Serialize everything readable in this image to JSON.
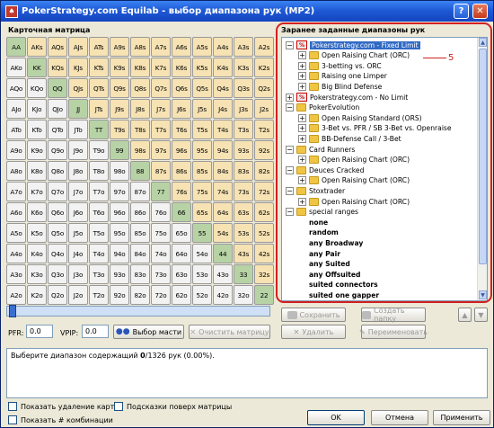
{
  "window": {
    "title": "PokerStrategy.com Equilab - выбор диапазона рук (MP2)",
    "help": "?",
    "close": "✕"
  },
  "matrix": {
    "label": "Карточная матрица",
    "rows": [
      [
        "AA",
        "AKs",
        "AQs",
        "AJs",
        "ATs",
        "A9s",
        "A8s",
        "A7s",
        "A6s",
        "A5s",
        "A4s",
        "A3s",
        "A2s"
      ],
      [
        "AKo",
        "KK",
        "KQs",
        "KJs",
        "KTs",
        "K9s",
        "K8s",
        "K7s",
        "K6s",
        "K5s",
        "K4s",
        "K3s",
        "K2s"
      ],
      [
        "AQo",
        "KQo",
        "QQ",
        "QJs",
        "QTs",
        "Q9s",
        "Q8s",
        "Q7s",
        "Q6s",
        "Q5s",
        "Q4s",
        "Q3s",
        "Q2s"
      ],
      [
        "AJo",
        "KJo",
        "QJo",
        "JJ",
        "JTs",
        "J9s",
        "J8s",
        "J7s",
        "J6s",
        "J5s",
        "J4s",
        "J3s",
        "J2s"
      ],
      [
        "ATo",
        "KTo",
        "QTo",
        "JTo",
        "TT",
        "T9s",
        "T8s",
        "T7s",
        "T6s",
        "T5s",
        "T4s",
        "T3s",
        "T2s"
      ],
      [
        "A9o",
        "K9o",
        "Q9o",
        "J9o",
        "T9o",
        "99",
        "98s",
        "97s",
        "96s",
        "95s",
        "94s",
        "93s",
        "92s"
      ],
      [
        "A8o",
        "K8o",
        "Q8o",
        "J8o",
        "T8o",
        "98o",
        "88",
        "87s",
        "86s",
        "85s",
        "84s",
        "83s",
        "82s"
      ],
      [
        "A7o",
        "K7o",
        "Q7o",
        "J7o",
        "T7o",
        "97o",
        "87o",
        "77",
        "76s",
        "75s",
        "74s",
        "73s",
        "72s"
      ],
      [
        "A6o",
        "K6o",
        "Q6o",
        "J6o",
        "T6o",
        "96o",
        "86o",
        "76o",
        "66",
        "65s",
        "64s",
        "63s",
        "62s"
      ],
      [
        "A5o",
        "K5o",
        "Q5o",
        "J5o",
        "T5o",
        "95o",
        "85o",
        "75o",
        "65o",
        "55",
        "54s",
        "53s",
        "52s"
      ],
      [
        "A4o",
        "K4o",
        "Q4o",
        "J4o",
        "T4o",
        "94o",
        "84o",
        "74o",
        "64o",
        "54o",
        "44",
        "43s",
        "42s"
      ],
      [
        "A3o",
        "K3o",
        "Q3o",
        "J3o",
        "T3o",
        "93o",
        "83o",
        "73o",
        "63o",
        "53o",
        "43o",
        "33",
        "32s"
      ],
      [
        "A2o",
        "K2o",
        "Q2o",
        "J2o",
        "T2o",
        "92o",
        "82o",
        "72o",
        "62o",
        "52o",
        "42o",
        "32o",
        "22"
      ]
    ]
  },
  "controls": {
    "pfr_label": "PFR:",
    "pfr_value": "0.0",
    "vpip_label": "VPIP:",
    "vpip_value": "0.0",
    "suit_button": "Выбор масти",
    "clear_button": "Очистить матрицу"
  },
  "presets": {
    "label": "Заранее заданные диапазоны рук",
    "annotation": "5",
    "save": "Сохранить",
    "delete": "Удалить",
    "new_folder": "Создать папку",
    "rename": "Переименовать",
    "tree": [
      {
        "d": 0,
        "t": "minus",
        "i": "ps",
        "text": "Pokerstrategy.com - Fixed Limit",
        "sel": true
      },
      {
        "d": 1,
        "t": "plus",
        "i": "folder",
        "text": "Open Raising Chart (ORC)"
      },
      {
        "d": 1,
        "t": "plus",
        "i": "folder",
        "text": "3-betting vs. ORC"
      },
      {
        "d": 1,
        "t": "plus",
        "i": "folder",
        "text": "Raising one Limper"
      },
      {
        "d": 1,
        "t": "plus",
        "i": "folder",
        "text": "Big Blind Defense"
      },
      {
        "d": 0,
        "t": "plus",
        "i": "ps",
        "text": "Pokerstrategy.com - No Limit"
      },
      {
        "d": 0,
        "t": "minus",
        "i": "folder",
        "text": "PokerEvolution"
      },
      {
        "d": 1,
        "t": "plus",
        "i": "folder",
        "text": "Open Raising Standard (ORS)"
      },
      {
        "d": 1,
        "t": "plus",
        "i": "folder",
        "text": "3-Bet vs. PFR / SB 3-Bet vs. Openraise"
      },
      {
        "d": 1,
        "t": "plus",
        "i": "folder",
        "text": "BB-Defense Call / 3-Bet"
      },
      {
        "d": 0,
        "t": "minus",
        "i": "folder",
        "text": "Card Runners"
      },
      {
        "d": 1,
        "t": "plus",
        "i": "folder",
        "text": "Open Raising Chart (ORC)"
      },
      {
        "d": 0,
        "t": "minus",
        "i": "folder",
        "text": "Deuces Cracked"
      },
      {
        "d": 1,
        "t": "plus",
        "i": "folder",
        "text": "Open Raising Chart (ORC)"
      },
      {
        "d": 0,
        "t": "minus",
        "i": "folder",
        "text": "Stoxtrader"
      },
      {
        "d": 1,
        "t": "plus",
        "i": "folder",
        "text": "Open Raising Chart (ORC)"
      },
      {
        "d": 0,
        "t": "minus",
        "i": "folder",
        "text": "special ranges"
      },
      {
        "d": 1,
        "t": "none",
        "i": "none",
        "text": "none",
        "bold": true
      },
      {
        "d": 1,
        "t": "none",
        "i": "none",
        "text": "random",
        "bold": true
      },
      {
        "d": 1,
        "t": "none",
        "i": "none",
        "text": "any Broadway",
        "bold": true
      },
      {
        "d": 1,
        "t": "none",
        "i": "none",
        "text": "any Pair",
        "bold": true
      },
      {
        "d": 1,
        "t": "none",
        "i": "none",
        "text": "any Suited",
        "bold": true
      },
      {
        "d": 1,
        "t": "none",
        "i": "none",
        "text": "any Offsuited",
        "bold": true
      },
      {
        "d": 1,
        "t": "none",
        "i": "none",
        "text": "suited connectors",
        "bold": true
      },
      {
        "d": 1,
        "t": "none",
        "i": "none",
        "text": "suited one gapper",
        "bold": true
      }
    ]
  },
  "info": {
    "text_prefix": "Выберите диапазон содержащий ",
    "count": "0",
    "text_suffix": "/1326 рук (0.00%)."
  },
  "options": {
    "show_dead": "Показать удаление карт",
    "show_combos": "Показать # комбинации",
    "tooltips": "Подсказки поверх матрицы"
  },
  "footer": {
    "ok": "OK",
    "cancel": "Отмена",
    "apply": "Применить"
  }
}
